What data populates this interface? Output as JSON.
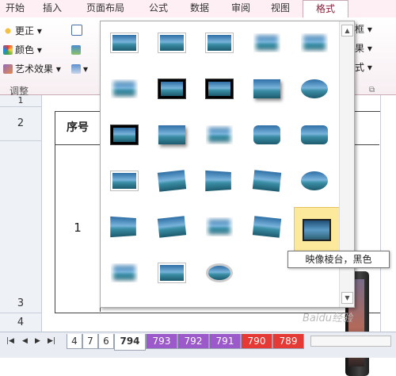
{
  "ribbon_tabs": [
    "开始",
    "插入",
    "页面布局",
    "公式",
    "数据",
    "审阅",
    "视图",
    "格式"
  ],
  "ribbon": {
    "items": [
      "更正 ▾",
      "颜色 ▾",
      "艺术效果 ▾"
    ],
    "group": "调整",
    "right_items": [
      "框 ▾",
      "果 ▾",
      "式 ▾"
    ]
  },
  "sheet": {
    "rows": [
      "1",
      "2",
      "3",
      "4"
    ],
    "header_cell": "序号",
    "value_cell": "1"
  },
  "gallery": {
    "tooltip": "映像棱台，黑色",
    "styles": [
      "white",
      "white",
      "white",
      "soft",
      "soft",
      "soft",
      "black",
      "black",
      "shadow",
      "oval",
      "black",
      "shadow",
      "soft",
      "round",
      "round",
      "white",
      "tilt",
      "persp",
      "tiltr",
      "oval",
      "persp",
      "tilt",
      "soft",
      "tiltr",
      "selected",
      "soft",
      "white",
      "ovalframe"
    ]
  },
  "sheet_tabs": [
    "4",
    "7",
    "6",
    "794",
    "793",
    "792",
    "791",
    "790",
    "789"
  ],
  "tab_colors": [
    "#ffffff",
    "#ffffff",
    "#ffffff",
    "#ffffff",
    "#9b59c9",
    "#9b59c9",
    "#9b59c9",
    "#e53935",
    "#e53935"
  ],
  "watermark": "Baidu经验"
}
